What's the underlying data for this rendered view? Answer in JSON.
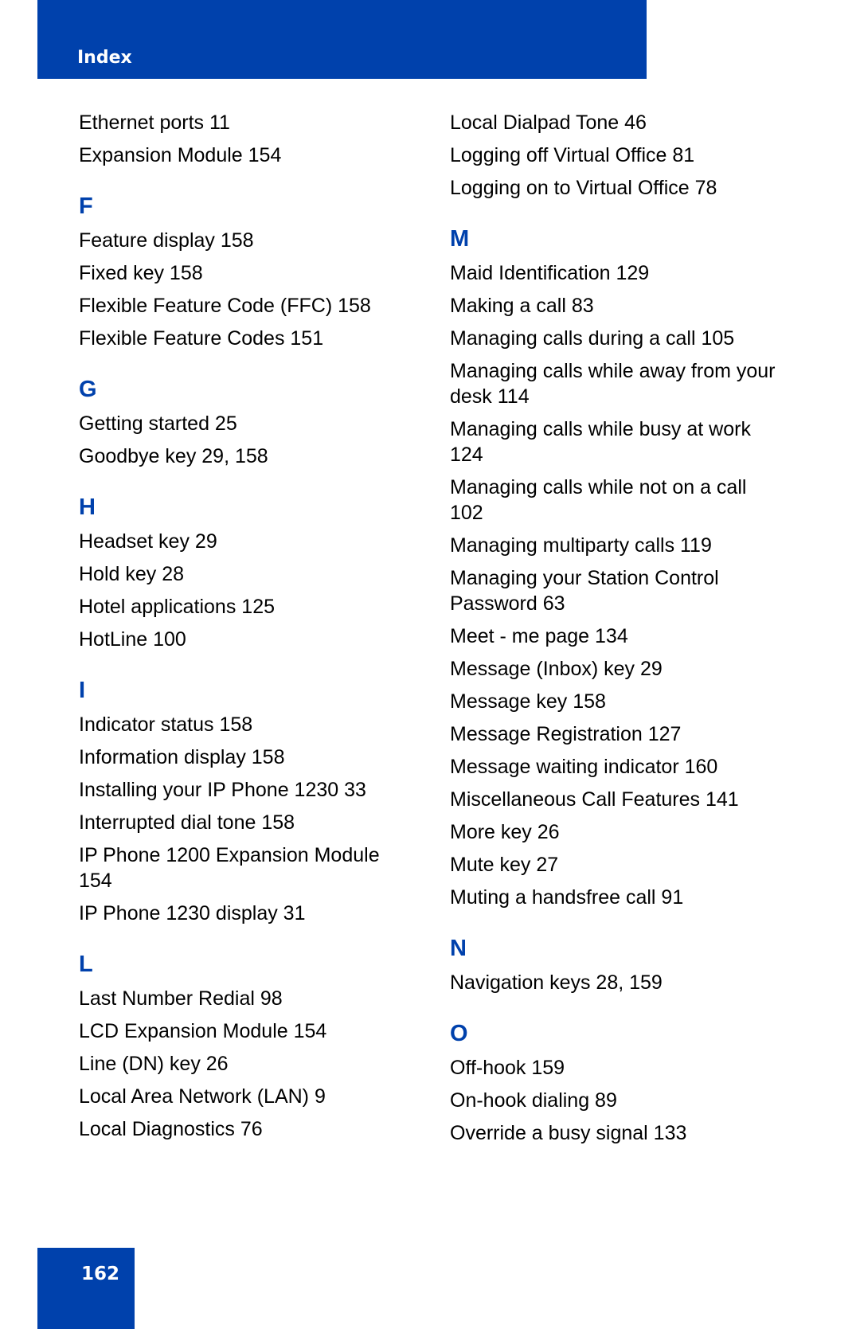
{
  "header": {
    "title": "Index",
    "color": "#0041ac"
  },
  "left_column": [
    {
      "type": "entry",
      "text": "Ethernet ports 11"
    },
    {
      "type": "entry",
      "text": "Expansion Module 154"
    },
    {
      "type": "letter",
      "text": "F"
    },
    {
      "type": "entry",
      "text": "Feature display 158"
    },
    {
      "type": "entry",
      "text": "Fixed key 158"
    },
    {
      "type": "entry",
      "text": "Flexible Feature Code (FFC) 158"
    },
    {
      "type": "entry",
      "text": "Flexible Feature Codes 151"
    },
    {
      "type": "letter",
      "text": "G"
    },
    {
      "type": "entry",
      "text": "Getting started 25"
    },
    {
      "type": "entry",
      "text": "Goodbye key 29, 158"
    },
    {
      "type": "letter",
      "text": "H"
    },
    {
      "type": "entry",
      "text": "Headset key 29"
    },
    {
      "type": "entry",
      "text": "Hold key 28"
    },
    {
      "type": "entry",
      "text": "Hotel applications 125"
    },
    {
      "type": "entry",
      "text": "HotLine 100"
    },
    {
      "type": "letter",
      "text": "I"
    },
    {
      "type": "entry",
      "text": "Indicator status 158"
    },
    {
      "type": "entry",
      "text": "Information display 158"
    },
    {
      "type": "entry",
      "text": "Installing your IP Phone 1230 33"
    },
    {
      "type": "entry",
      "text": "Interrupted dial tone 158"
    },
    {
      "type": "entry",
      "text": "IP Phone 1200 Expansion Module 154"
    },
    {
      "type": "entry",
      "text": "IP Phone 1230 display 31"
    },
    {
      "type": "letter",
      "text": "L"
    },
    {
      "type": "entry",
      "text": "Last Number Redial 98"
    },
    {
      "type": "entry",
      "text": "LCD Expansion Module 154"
    },
    {
      "type": "entry",
      "text": "Line (DN) key 26"
    },
    {
      "type": "entry",
      "text": "Local Area Network (LAN) 9"
    },
    {
      "type": "entry",
      "text": "Local Diagnostics 76"
    }
  ],
  "right_column": [
    {
      "type": "entry",
      "text": "Local Dialpad Tone 46"
    },
    {
      "type": "entry",
      "text": "Logging off Virtual Office 81"
    },
    {
      "type": "entry",
      "text": "Logging on to Virtual Office 78"
    },
    {
      "type": "letter",
      "text": "M"
    },
    {
      "type": "entry",
      "text": "Maid Identification 129"
    },
    {
      "type": "entry",
      "text": "Making a call 83"
    },
    {
      "type": "entry",
      "text": "Managing calls during a call 105"
    },
    {
      "type": "entry",
      "text": "Managing calls while away from your desk 114"
    },
    {
      "type": "entry",
      "text": "Managing calls while busy at work 124"
    },
    {
      "type": "entry",
      "text": "Managing calls while not on a call 102"
    },
    {
      "type": "entry",
      "text": "Managing multiparty calls 119"
    },
    {
      "type": "entry",
      "text": "Managing your Station Control Password 63"
    },
    {
      "type": "entry",
      "text": "Meet - me page 134"
    },
    {
      "type": "entry",
      "text": "Message (Inbox) key 29"
    },
    {
      "type": "entry",
      "text": "Message key 158"
    },
    {
      "type": "entry",
      "text": "Message Registration 127"
    },
    {
      "type": "entry",
      "text": "Message waiting indicator 160"
    },
    {
      "type": "entry",
      "text": "Miscellaneous Call Features 141"
    },
    {
      "type": "entry",
      "text": "More key 26"
    },
    {
      "type": "entry",
      "text": "Mute key 27"
    },
    {
      "type": "entry",
      "text": "Muting a handsfree call 91"
    },
    {
      "type": "letter",
      "text": "N"
    },
    {
      "type": "entry",
      "text": "Navigation keys 28, 159"
    },
    {
      "type": "letter",
      "text": "O"
    },
    {
      "type": "entry",
      "text": "Off-hook 159"
    },
    {
      "type": "entry",
      "text": "On-hook dialing 89"
    },
    {
      "type": "entry",
      "text": "Override a busy signal 133"
    }
  ],
  "footer": {
    "page_number": "162"
  }
}
